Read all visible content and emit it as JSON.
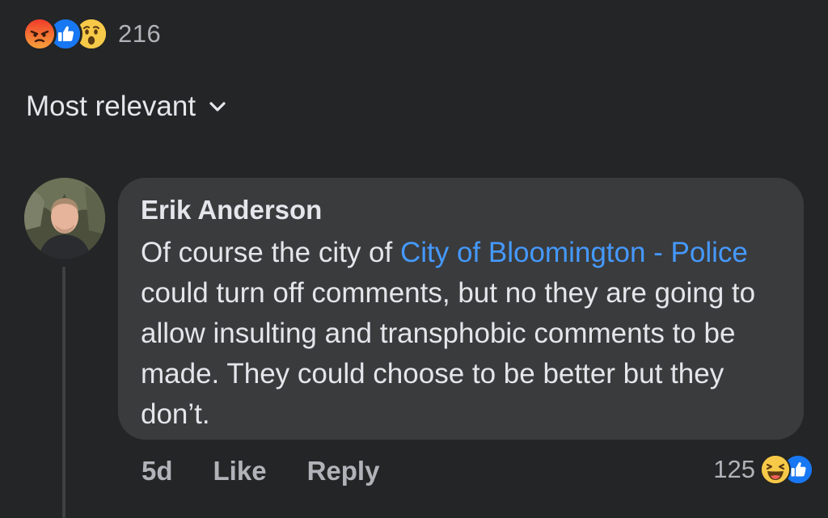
{
  "post_reactions": {
    "icons": [
      "angry-icon",
      "like-icon",
      "wow-icon"
    ],
    "count": "216"
  },
  "sort": {
    "label": "Most relevant",
    "icon": "chevron-down-icon"
  },
  "comment": {
    "author": "Erik Anderson",
    "text_before": "Of course the city of ",
    "mention": "City of Bloomington - Police",
    "text_after": " could turn off comments, but no they are going to allow insulting and transphobic comments to be made.  They could choose to be better but they don’t.",
    "time": "5d",
    "like_label": "Like",
    "reply_label": "Reply",
    "reaction_count": "125",
    "reaction_icons": [
      "haha-icon",
      "like-icon"
    ]
  },
  "colors": {
    "background": "#242526",
    "bubble": "#3a3b3c",
    "mention": "#4599ff",
    "secondary_text": "#b0b3b8",
    "like_blue": "#1877f2",
    "angry_orange": "#f0552a",
    "emoji_yellow": "#f7c948"
  }
}
